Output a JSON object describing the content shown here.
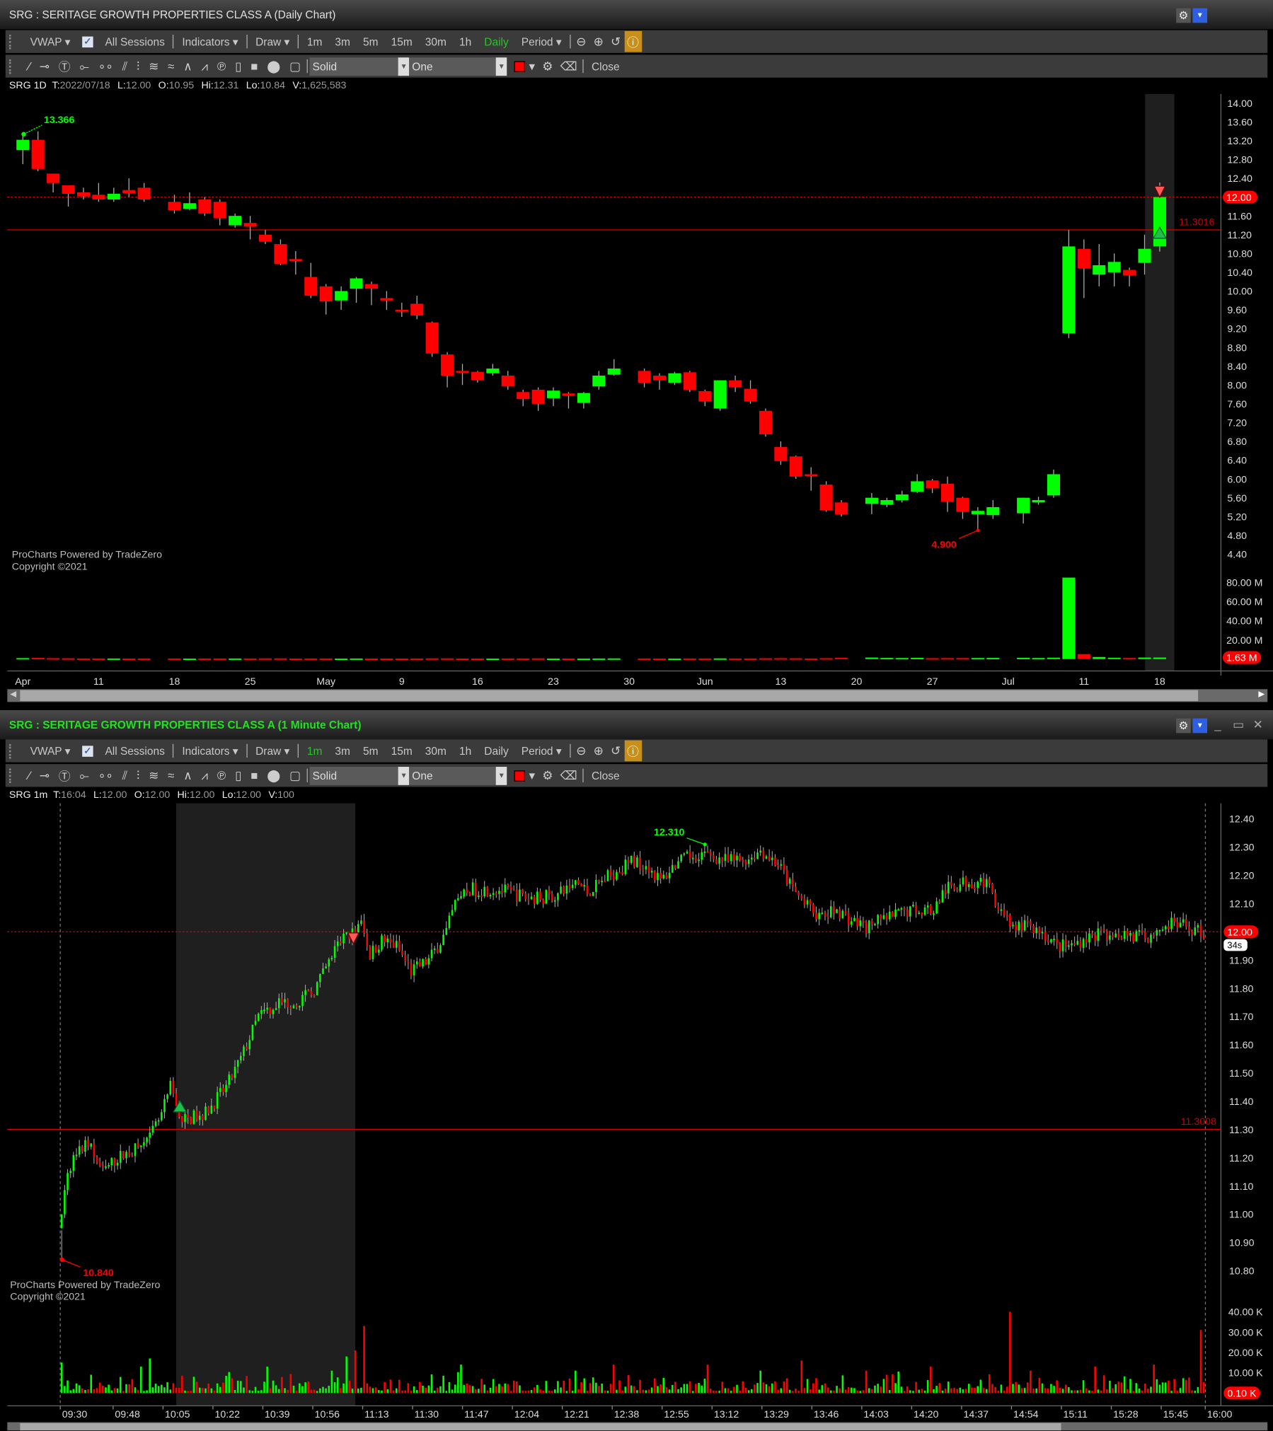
{
  "windows": [
    {
      "title": "SRG : SERITAGE GROWTH PROPERTIES CLASS A (Daily Chart)",
      "info": {
        "sym": "SRG 1D",
        "t": "2022/07/18",
        "l": "12.00",
        "o": "10.95",
        "hi": "12.31",
        "lo": "10.84",
        "v": "1,625,583"
      },
      "active_period": "Daily"
    },
    {
      "title": "SRG : SERITAGE GROWTH PROPERTIES CLASS A (1 Minute Chart)",
      "info": {
        "sym": "SRG 1m",
        "t": "16:04",
        "l": "12.00",
        "o": "12.00",
        "hi": "12.00",
        "lo": "12.00",
        "v": "100"
      },
      "active_period": "1m"
    }
  ],
  "toolbar": {
    "vwap": "VWAP",
    "all_sessions": "All Sessions",
    "indicators": "Indicators",
    "draw": "Draw",
    "periods": [
      "1m",
      "3m",
      "5m",
      "15m",
      "30m",
      "1h",
      "Daily"
    ],
    "period": "Period",
    "line_style": "Solid",
    "line_scope": "One",
    "close": "Close"
  },
  "labels": {
    "t": "T:",
    "l": "L:",
    "o": "O:",
    "hi": "Hi:",
    "lo": "Lo:",
    "v": "V:"
  },
  "watermark": [
    "ProCharts Powered by TradeZero",
    "Copyright ©2021"
  ],
  "colors": {
    "up": "#00ff00",
    "down": "#ff0000",
    "accent": "#c8901a",
    "badge": "#ff0000"
  },
  "chart_data": [
    {
      "type": "candlestick",
      "title": "SRG Daily",
      "ylim": [
        4.2,
        14.2
      ],
      "yticks": [
        "14.00",
        "13.60",
        "13.20",
        "12.80",
        "12.40",
        "12.00",
        "11.60",
        "11.20",
        "10.80",
        "10.40",
        "10.00",
        "9.60",
        "9.20",
        "8.80",
        "8.40",
        "8.00",
        "7.60",
        "7.20",
        "6.80",
        "6.40",
        "6.00",
        "5.60",
        "5.20",
        "4.80",
        "4.40"
      ],
      "vol_ticks": [
        "80.00 M",
        "60.00 M",
        "40.00 M",
        "20.00 M"
      ],
      "xticks": [
        [
          "Apr",
          0
        ],
        [
          "11",
          5
        ],
        [
          "18",
          10
        ],
        [
          "25",
          15
        ],
        [
          "May",
          20
        ],
        [
          "9",
          25
        ],
        [
          "16",
          30
        ],
        [
          "23",
          35
        ],
        [
          "30",
          40
        ],
        [
          "Jun",
          45
        ],
        [
          "13",
          50
        ],
        [
          "20",
          55
        ],
        [
          "27",
          60
        ],
        [
          "Jul",
          65
        ],
        [
          "11",
          70
        ],
        [
          "18",
          75
        ]
      ],
      "last_price": "12.00",
      "last_volume": "1.63 M",
      "hline_label": "11.3016",
      "hline": 11.3016,
      "high_label": "13.366",
      "low_label": "4.900",
      "candles_fields": [
        "weekday_index",
        "open",
        "high",
        "low",
        "close",
        "volume_M"
      ],
      "candles": [
        [
          0,
          13.0,
          13.37,
          12.7,
          13.22,
          1.0
        ],
        [
          1,
          13.22,
          13.4,
          12.55,
          12.6,
          1.2
        ],
        [
          2,
          12.5,
          12.5,
          12.1,
          12.3,
          0.9
        ],
        [
          3,
          12.25,
          12.25,
          11.8,
          12.07,
          0.8
        ],
        [
          4,
          12.1,
          12.2,
          11.95,
          12.02,
          0.6
        ],
        [
          5,
          12.05,
          12.3,
          11.9,
          11.95,
          0.6
        ],
        [
          6,
          11.95,
          12.2,
          11.9,
          12.07,
          0.6
        ],
        [
          7,
          12.15,
          12.4,
          12.0,
          12.08,
          0.5
        ],
        [
          8,
          12.2,
          12.3,
          11.9,
          11.95,
          0.6
        ],
        [
          10,
          11.9,
          12.05,
          11.65,
          11.72,
          0.6
        ],
        [
          11,
          11.75,
          12.1,
          11.72,
          11.87,
          0.5
        ],
        [
          12,
          11.95,
          12.0,
          11.6,
          11.65,
          0.6
        ],
        [
          13,
          11.9,
          11.95,
          11.4,
          11.55,
          0.6
        ],
        [
          14,
          11.4,
          11.65,
          11.35,
          11.6,
          0.6
        ],
        [
          15,
          11.45,
          11.6,
          11.1,
          11.37,
          0.6
        ],
        [
          16,
          11.2,
          11.3,
          11.0,
          11.05,
          0.7
        ],
        [
          17,
          11.0,
          11.1,
          10.55,
          10.58,
          0.7
        ],
        [
          18,
          10.68,
          10.85,
          10.35,
          10.64,
          0.5
        ],
        [
          19,
          10.3,
          10.6,
          9.85,
          9.9,
          0.6
        ],
        [
          20,
          10.1,
          10.15,
          9.5,
          9.78,
          0.6
        ],
        [
          21,
          9.8,
          10.1,
          9.6,
          10.0,
          0.5
        ],
        [
          22,
          10.05,
          10.3,
          9.75,
          10.27,
          0.6
        ],
        [
          23,
          10.15,
          10.2,
          9.7,
          10.05,
          0.5
        ],
        [
          24,
          9.85,
          10.0,
          9.6,
          9.8,
          0.5
        ],
        [
          25,
          9.6,
          9.75,
          9.45,
          9.57,
          0.5
        ],
        [
          26,
          9.73,
          9.9,
          9.4,
          9.48,
          0.6
        ],
        [
          27,
          9.33,
          9.35,
          8.6,
          8.67,
          0.7
        ],
        [
          28,
          8.65,
          8.7,
          7.95,
          8.2,
          0.7
        ],
        [
          29,
          8.3,
          8.45,
          8.0,
          8.27,
          0.5
        ],
        [
          30,
          8.28,
          8.3,
          8.05,
          8.1,
          0.5
        ],
        [
          31,
          8.25,
          8.45,
          8.2,
          8.35,
          0.5
        ],
        [
          32,
          8.2,
          8.3,
          7.9,
          7.97,
          0.6
        ],
        [
          33,
          7.85,
          7.9,
          7.55,
          7.7,
          0.6
        ],
        [
          34,
          7.9,
          7.95,
          7.45,
          7.6,
          0.7
        ],
        [
          35,
          7.72,
          7.95,
          7.55,
          7.88,
          0.5
        ],
        [
          36,
          7.82,
          7.85,
          7.5,
          7.77,
          0.5
        ],
        [
          37,
          7.62,
          7.85,
          7.5,
          7.83,
          0.5
        ],
        [
          38,
          7.97,
          8.3,
          7.9,
          8.2,
          0.6
        ],
        [
          39,
          8.22,
          8.55,
          8.2,
          8.35,
          0.7
        ],
        [
          41,
          8.3,
          8.35,
          7.95,
          8.05,
          0.6
        ],
        [
          42,
          8.2,
          8.25,
          7.9,
          8.1,
          0.5
        ],
        [
          43,
          8.05,
          8.28,
          8.0,
          8.25,
          0.5
        ],
        [
          44,
          8.27,
          8.3,
          7.85,
          7.9,
          0.6
        ],
        [
          45,
          7.87,
          7.9,
          7.55,
          7.65,
          0.6
        ],
        [
          46,
          7.5,
          8.1,
          7.45,
          8.1,
          0.7
        ],
        [
          47,
          8.1,
          8.2,
          7.85,
          7.95,
          0.6
        ],
        [
          48,
          7.92,
          8.1,
          7.6,
          7.65,
          0.6
        ],
        [
          49,
          7.45,
          7.5,
          6.9,
          6.95,
          0.8
        ],
        [
          50,
          6.68,
          6.8,
          6.3,
          6.38,
          0.9
        ],
        [
          51,
          6.48,
          6.5,
          6.0,
          6.05,
          0.8
        ],
        [
          52,
          6.1,
          6.25,
          5.75,
          6.07,
          0.6
        ],
        [
          53,
          5.88,
          5.95,
          5.3,
          5.33,
          0.9
        ],
        [
          54,
          5.5,
          5.55,
          5.2,
          5.25,
          1.4
        ],
        [
          56,
          5.47,
          5.7,
          5.25,
          5.6,
          1.6
        ],
        [
          57,
          5.45,
          5.6,
          5.4,
          5.55,
          1.2
        ],
        [
          58,
          5.55,
          5.75,
          5.5,
          5.67,
          1.1
        ],
        [
          59,
          5.73,
          6.1,
          5.7,
          5.95,
          1.3
        ],
        [
          60,
          5.97,
          6.0,
          5.7,
          5.8,
          0.9
        ],
        [
          61,
          5.9,
          6.05,
          5.3,
          5.52,
          1.0
        ],
        [
          62,
          5.6,
          5.62,
          5.15,
          5.3,
          1.0
        ],
        [
          63,
          5.25,
          5.4,
          4.9,
          5.32,
          1.1
        ],
        [
          64,
          5.23,
          5.55,
          5.15,
          5.4,
          1.2
        ],
        [
          66,
          5.27,
          5.6,
          5.05,
          5.6,
          1.3
        ],
        [
          67,
          5.5,
          5.62,
          5.45,
          5.55,
          1.1
        ],
        [
          68,
          5.65,
          6.2,
          5.6,
          6.1,
          1.5
        ],
        [
          69,
          9.1,
          11.3,
          9.0,
          10.95,
          85.0
        ],
        [
          70,
          10.9,
          11.1,
          9.85,
          10.48,
          5.2
        ],
        [
          71,
          10.35,
          11.0,
          10.1,
          10.55,
          2.2
        ],
        [
          72,
          10.4,
          10.8,
          10.1,
          10.62,
          1.4
        ],
        [
          73,
          10.45,
          10.5,
          10.1,
          10.33,
          1.1
        ],
        [
          74,
          10.6,
          11.2,
          10.35,
          10.9,
          1.6
        ],
        [
          75,
          10.95,
          12.31,
          10.84,
          12.0,
          1.63
        ]
      ]
    },
    {
      "type": "ohlc-intraday",
      "title": "SRG 1 Minute",
      "ylim": [
        10.7,
        12.45
      ],
      "yticks": [
        "12.40",
        "12.30",
        "12.20",
        "12.10",
        "12.00",
        "11.90",
        "11.80",
        "11.70",
        "11.60",
        "11.50",
        "11.40",
        "11.30",
        "11.20",
        "11.10",
        "11.00",
        "10.90",
        "10.80"
      ],
      "vol_ticks": [
        "40.00 K",
        "30.00 K",
        "20.00 K",
        "10.00 K"
      ],
      "xticks": [
        [
          "09:30",
          0
        ],
        [
          "09:48",
          18
        ],
        [
          "10:05",
          35
        ],
        [
          "10:22",
          52
        ],
        [
          "10:39",
          69
        ],
        [
          "10:56",
          86
        ],
        [
          "11:13",
          103
        ],
        [
          "11:30",
          120
        ],
        [
          "11:47",
          137
        ],
        [
          "12:04",
          154
        ],
        [
          "12:21",
          171
        ],
        [
          "12:38",
          188
        ],
        [
          "12:55",
          205
        ],
        [
          "13:12",
          222
        ],
        [
          "13:29",
          239
        ],
        [
          "13:46",
          256
        ],
        [
          "14:03",
          273
        ],
        [
          "14:20",
          290
        ],
        [
          "14:37",
          307
        ],
        [
          "14:54",
          324
        ],
        [
          "15:11",
          341
        ],
        [
          "15:28",
          358
        ],
        [
          "15:45",
          375
        ],
        [
          "16:00",
          390
        ]
      ],
      "last_price": "12.00",
      "countdown": "34s",
      "last_volume": "0.10 K",
      "hline_label": "11.3008",
      "hline": 11.3008,
      "high_label": "12.310",
      "low_label": "10.840",
      "price_path_fields": [
        "minute_since_open",
        "price"
      ],
      "price_path": [
        [
          0,
          10.95
        ],
        [
          2,
          11.1
        ],
        [
          5,
          11.2
        ],
        [
          10,
          11.25
        ],
        [
          15,
          11.15
        ],
        [
          20,
          11.2
        ],
        [
          30,
          11.25
        ],
        [
          35,
          11.35
        ],
        [
          38,
          11.45
        ],
        [
          42,
          11.33
        ],
        [
          50,
          11.36
        ],
        [
          57,
          11.45
        ],
        [
          62,
          11.55
        ],
        [
          68,
          11.7
        ],
        [
          75,
          11.75
        ],
        [
          80,
          11.75
        ],
        [
          86,
          11.78
        ],
        [
          90,
          11.85
        ],
        [
          96,
          11.97
        ],
        [
          101,
          12.0
        ],
        [
          103,
          12.03
        ],
        [
          106,
          11.92
        ],
        [
          110,
          11.97
        ],
        [
          115,
          11.95
        ],
        [
          120,
          11.86
        ],
        [
          126,
          11.9
        ],
        [
          132,
          12.0
        ],
        [
          135,
          12.1
        ],
        [
          140,
          12.15
        ],
        [
          150,
          12.15
        ],
        [
          160,
          12.12
        ],
        [
          170,
          12.13
        ],
        [
          176,
          12.18
        ],
        [
          180,
          12.14
        ],
        [
          185,
          12.18
        ],
        [
          195,
          12.25
        ],
        [
          200,
          12.24
        ],
        [
          205,
          12.18
        ],
        [
          210,
          12.24
        ],
        [
          218,
          12.28
        ],
        [
          222,
          12.27
        ],
        [
          228,
          12.25
        ],
        [
          235,
          12.26
        ],
        [
          239,
          12.29
        ],
        [
          245,
          12.24
        ],
        [
          250,
          12.15
        ],
        [
          256,
          12.08
        ],
        [
          260,
          12.05
        ],
        [
          265,
          12.08
        ],
        [
          270,
          12.04
        ],
        [
          275,
          12.02
        ],
        [
          280,
          12.04
        ],
        [
          290,
          12.08
        ],
        [
          298,
          12.08
        ],
        [
          302,
          12.15
        ],
        [
          310,
          12.18
        ],
        [
          315,
          12.18
        ],
        [
          320,
          12.1
        ],
        [
          325,
          12.02
        ],
        [
          330,
          12.02
        ],
        [
          335,
          12.0
        ],
        [
          340,
          11.95
        ],
        [
          345,
          11.95
        ],
        [
          350,
          11.98
        ],
        [
          360,
          12.0
        ],
        [
          370,
          11.98
        ],
        [
          375,
          12.01
        ],
        [
          380,
          12.03
        ],
        [
          389,
          12.0
        ]
      ],
      "volume_spikes_K": [
        [
          0,
          15
        ],
        [
          10,
          9
        ],
        [
          27,
          13
        ],
        [
          30,
          17
        ],
        [
          45,
          8
        ],
        [
          70,
          13
        ],
        [
          92,
          11
        ],
        [
          97,
          18
        ],
        [
          100,
          21
        ],
        [
          103,
          33
        ],
        [
          136,
          14
        ],
        [
          175,
          11
        ],
        [
          188,
          14
        ],
        [
          220,
          14
        ],
        [
          238,
          11
        ],
        [
          252,
          16
        ],
        [
          274,
          11
        ],
        [
          296,
          13
        ],
        [
          323,
          40
        ],
        [
          330,
          11
        ],
        [
          352,
          13
        ],
        [
          372,
          14
        ],
        [
          388,
          31
        ]
      ]
    }
  ]
}
